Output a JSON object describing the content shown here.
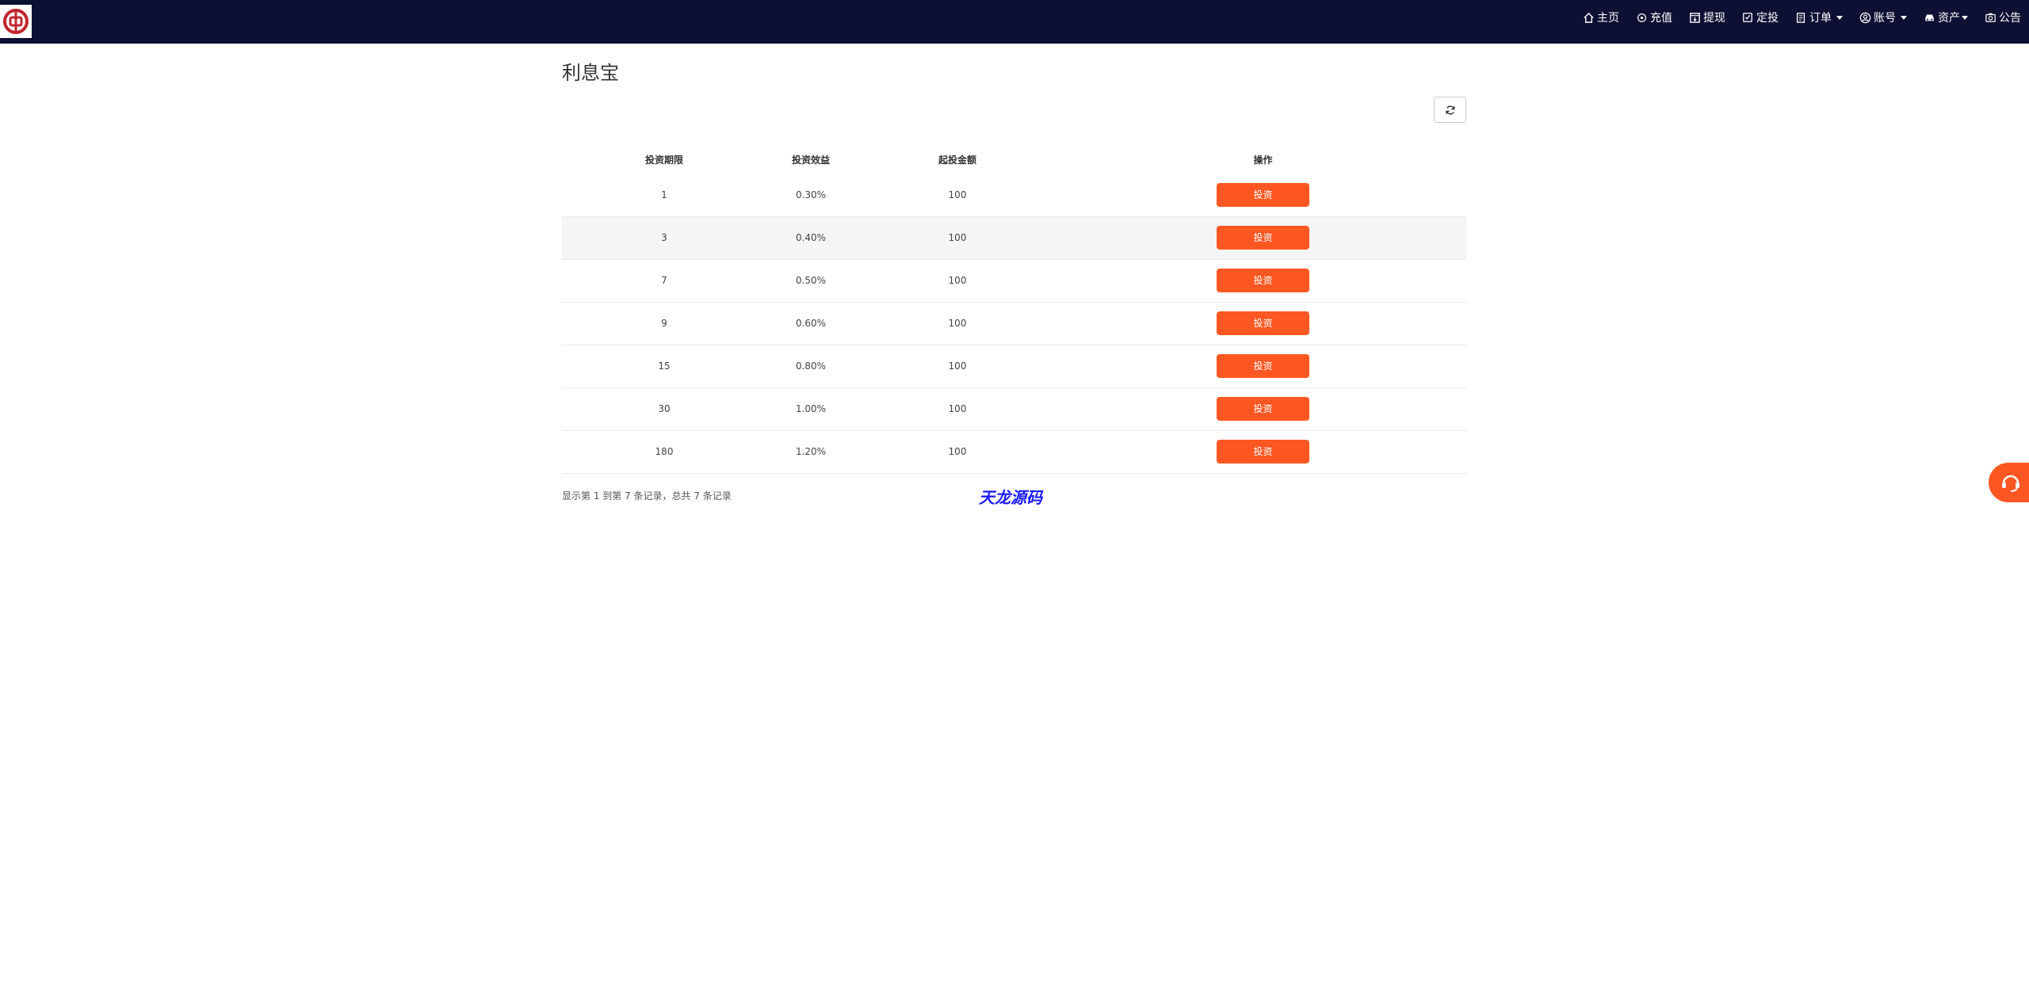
{
  "nav": {
    "items": [
      {
        "label": "主页",
        "icon": "home-icon"
      },
      {
        "label": "充值",
        "icon": "plus-circle-icon"
      },
      {
        "label": "提现",
        "icon": "withdraw-icon"
      },
      {
        "label": "定投",
        "icon": "check-square-icon"
      },
      {
        "label": "订单",
        "icon": "document-icon"
      },
      {
        "label": "账号",
        "icon": "user-circle-icon"
      },
      {
        "label": "资产",
        "icon": "car-icon"
      },
      {
        "label": "公告",
        "icon": "camera-icon"
      }
    ]
  },
  "page": {
    "title": "利息宝"
  },
  "table": {
    "headers": [
      "投资期限",
      "投资效益",
      "起投金额",
      "操作"
    ],
    "rows": [
      {
        "term": "1",
        "rate": "0.30%",
        "amount": "100",
        "action": "投资"
      },
      {
        "term": "3",
        "rate": "0.40%",
        "amount": "100",
        "action": "投资"
      },
      {
        "term": "7",
        "rate": "0.50%",
        "amount": "100",
        "action": "投资"
      },
      {
        "term": "9",
        "rate": "0.60%",
        "amount": "100",
        "action": "投资"
      },
      {
        "term": "15",
        "rate": "0.80%",
        "amount": "100",
        "action": "投资"
      },
      {
        "term": "30",
        "rate": "1.00%",
        "amount": "100",
        "action": "投资"
      },
      {
        "term": "180",
        "rate": "1.20%",
        "amount": "100",
        "action": "投资"
      }
    ]
  },
  "pagination": {
    "info": "显示第 1 到第 7 条记录，总共 7 条记录"
  },
  "watermark": {
    "text": "天龙源码"
  },
  "colors": {
    "navbar": "#0d1033",
    "accent": "#ff5722",
    "logo_red": "#c0262d"
  }
}
